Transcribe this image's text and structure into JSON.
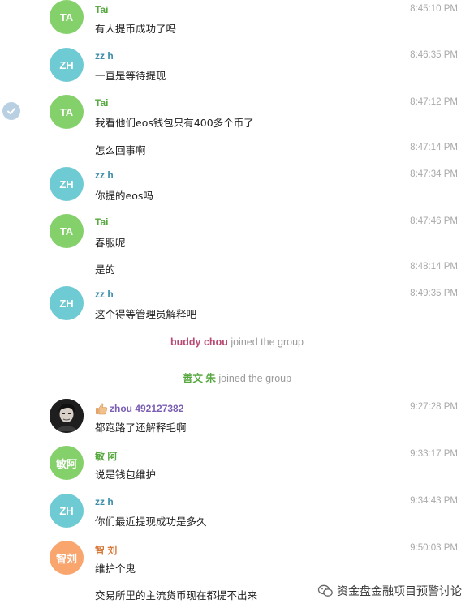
{
  "colors": {
    "green_avatar": "#84d06a",
    "cyan_avatar": "#6fcbd3",
    "orange_avatar": "#f9a56e",
    "green_name": "#56a83f",
    "cyan_name": "#3d8ea8",
    "purple_name": "#7b5fb4",
    "orange_name": "#d77a3a",
    "pink_name": "#b84a74"
  },
  "messages": [
    {
      "avatar": "TA",
      "name": "Tai",
      "text": "有人提币成功了吗",
      "time": "8:45:10 PM"
    },
    {
      "avatar": "ZH",
      "name": "zz h",
      "text": "一直是等待提现",
      "time": "8:46:35 PM"
    },
    {
      "avatar": "TA",
      "name": "Tai",
      "text": "我看他们eos钱包只有400多个币了",
      "time": "8:47:12 PM"
    },
    {
      "text": "怎么回事啊",
      "time": "8:47:14 PM"
    },
    {
      "avatar": "ZH",
      "name": "zz h",
      "text": "你提的eos吗",
      "time": "8:47:34 PM"
    },
    {
      "avatar": "TA",
      "name": "Tai",
      "text": "春服呢",
      "time": "8:47:46 PM"
    },
    {
      "text": "是的",
      "time": "8:48:14 PM"
    },
    {
      "avatar": "ZH",
      "name": "zz h",
      "text": "这个得等管理员解释吧",
      "time": "8:49:35 PM"
    },
    {
      "name": "zhou 492127382",
      "text": "都跑路了还解释毛啊",
      "time": "9:27:28 PM"
    },
    {
      "avatar": "敏阿",
      "name": "敏 阿",
      "text": "说是钱包维护",
      "time": "9:33:17 PM"
    },
    {
      "avatar": "ZH",
      "name": "zz h",
      "text": "你们最近提现成功是多久",
      "time": "9:34:43 PM"
    },
    {
      "avatar": "智刘",
      "name": "智 刘",
      "text": "维护个鬼",
      "time": "9:50:03 PM"
    },
    {
      "text": "交易所里的主流货币现在都提不出来"
    }
  ],
  "events": [
    {
      "who": "buddy chou",
      "action": "joined the group"
    },
    {
      "who": "善文 朱",
      "action": "joined the group"
    }
  ],
  "watermark": "资金盘金融项目预警讨论"
}
